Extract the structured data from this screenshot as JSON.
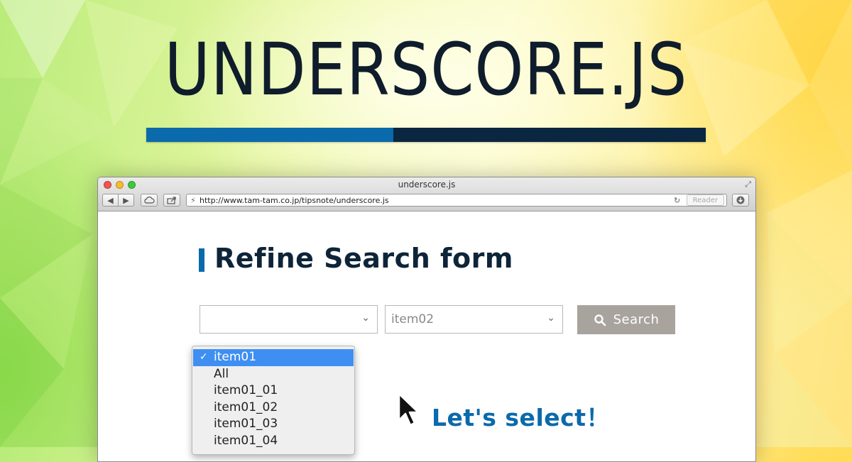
{
  "hero": {
    "title": "UNDERSCORE.JS",
    "bar_colors": [
      "#0a6aab",
      "#0a2640"
    ]
  },
  "window": {
    "title": "underscore.js",
    "url": "http://www.tam-tam.co.jp/tipsnote/underscore.js",
    "reader_label": "Reader",
    "icons": {
      "back": "back-arrow-icon",
      "forward": "forward-arrow-icon",
      "cloud": "cloud-icon",
      "share": "share-icon",
      "site": "site-icon",
      "reload": "reload-icon",
      "download": "download-icon",
      "resize": "fullscreen-icon"
    }
  },
  "page": {
    "heading": "Refine Search form",
    "select1": {
      "value": ""
    },
    "select2": {
      "value": "item02"
    },
    "search_button": {
      "label": "Search",
      "icon": "search-icon",
      "color": "#a9a39e"
    },
    "dropdown": {
      "options": [
        {
          "label": "item01",
          "selected": true
        },
        {
          "label": "All",
          "selected": false
        },
        {
          "label": "item01_01",
          "selected": false
        },
        {
          "label": "item01_02",
          "selected": false
        },
        {
          "label": "item01_03",
          "selected": false
        },
        {
          "label": "item01_04",
          "selected": false
        }
      ],
      "selected_color": "#3f8ff2"
    },
    "callout": "Let's select！",
    "accent_color": "#0a6aab"
  }
}
